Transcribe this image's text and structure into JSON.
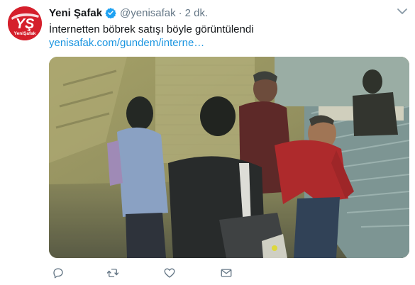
{
  "tweet": {
    "author_name": "Yeni Şafak",
    "handle": "@yenisafak",
    "separator": "·",
    "time": "2 dk.",
    "text": "İnternetten böbrek satışı böyle görüntülendi",
    "link": "yenisafak.com/gundem/interne…"
  },
  "avatar": {
    "logo_letters": "YŞ",
    "logo_wordmark": "YeniŞafak",
    "bg_color": "#d51f2b"
  },
  "colors": {
    "name": "#14171a",
    "secondary": "#657786",
    "link": "#1b95e0",
    "verified": "#1da1f2"
  },
  "actions": [
    "reply-icon",
    "retweet-icon",
    "like-icon",
    "direct-message-icon"
  ],
  "menu_icon": "chevron-down-icon"
}
